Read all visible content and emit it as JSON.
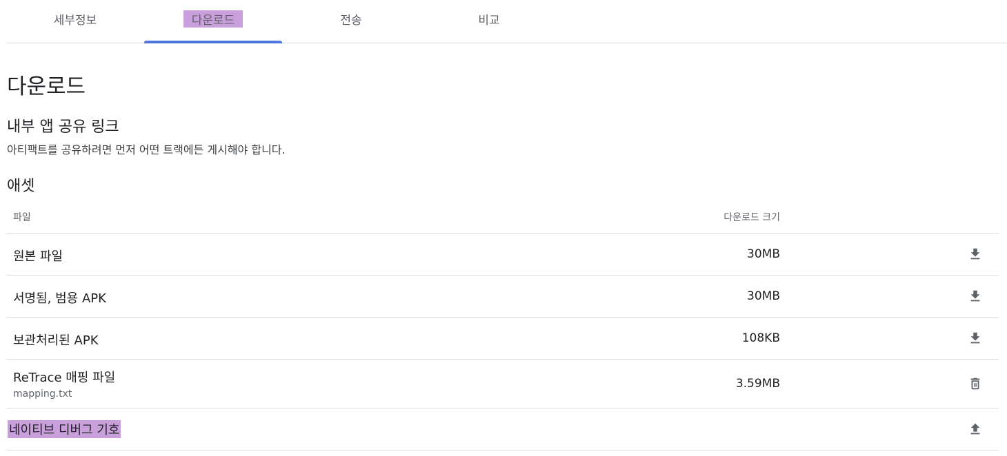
{
  "tabs": [
    {
      "label": "세부정보",
      "active": false
    },
    {
      "label": "다운로드",
      "active": true
    },
    {
      "label": "전송",
      "active": false
    },
    {
      "label": "비교",
      "active": false
    }
  ],
  "page_title": "다운로드",
  "share": {
    "title": "내부 앱 공유 링크",
    "description": "아티팩트를 공유하려면 먼저 어떤 트랙에든 게시해야 합니다."
  },
  "assets": {
    "title": "애셋",
    "columns": {
      "file": "파일",
      "size": "다운로드 크기"
    },
    "rows": [
      {
        "name": "원본 파일",
        "size": "30MB",
        "action_icon": "download-icon"
      },
      {
        "name": "서명됨, 범용 APK",
        "size": "30MB",
        "action_icon": "download-icon"
      },
      {
        "name": "보관처리된 APK",
        "size": "108KB",
        "action_icon": "download-icon"
      },
      {
        "name": "ReTrace 매핑 파일",
        "sub": "mapping.txt",
        "size": "3.59MB",
        "action_icon": "delete-icon"
      },
      {
        "name": "네이티브 디버그 기호",
        "size": "",
        "action_icon": "upload-icon"
      }
    ]
  },
  "colors": {
    "accent": "#4f76e0",
    "highlight": "#c9a0dc",
    "divider": "#dadce0"
  }
}
